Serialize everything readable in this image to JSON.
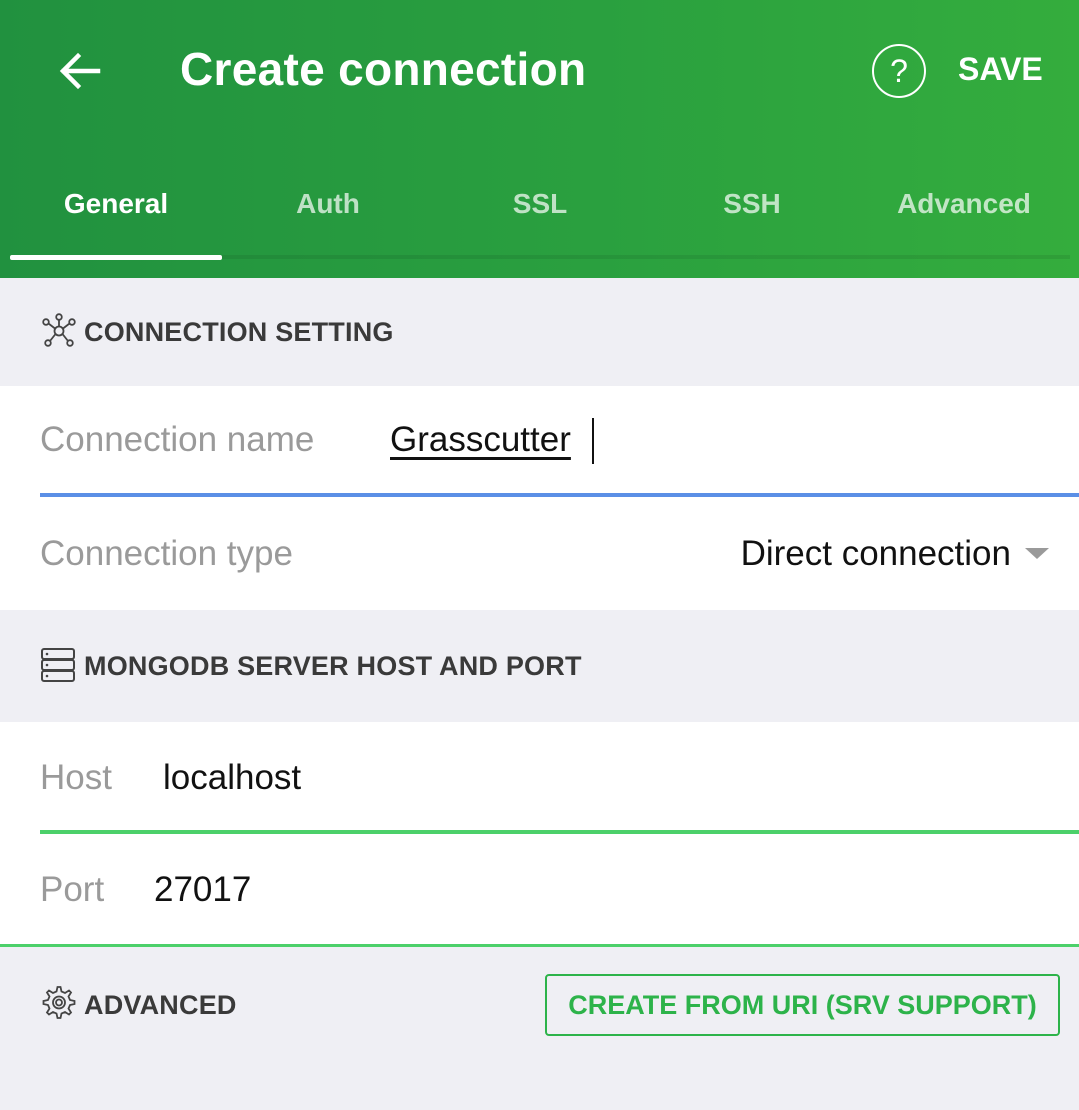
{
  "header": {
    "title": "Create connection",
    "back_icon": "arrow-back-icon",
    "help_icon": "help-circle-icon",
    "help_glyph": "?",
    "save_label": "SAVE",
    "bg_color_start": "#21913f",
    "bg_color_end": "#34ad3d"
  },
  "tabs": [
    {
      "label": "General",
      "active": true
    },
    {
      "label": "Auth",
      "active": false
    },
    {
      "label": "SSL",
      "active": false
    },
    {
      "label": "SSH",
      "active": false
    },
    {
      "label": "Advanced",
      "active": false
    }
  ],
  "sections": {
    "connection_setting": {
      "label": "CONNECTION SETTING",
      "icon": "network-icon"
    },
    "host_port": {
      "label": "MONGODB SERVER HOST AND PORT",
      "icon": "server-icon"
    },
    "advanced": {
      "label": "ADVANCED",
      "icon": "gear-icon"
    }
  },
  "fields": {
    "connection_name": {
      "label": "Connection name",
      "value": "Grasscutter"
    },
    "connection_type": {
      "label": "Connection type",
      "value": "Direct connection"
    },
    "host": {
      "label": "Host",
      "value": "localhost"
    },
    "port": {
      "label": "Port",
      "value": "27017"
    }
  },
  "buttons": {
    "create_from_uri": "CREATE FROM URI (SRV SUPPORT)"
  },
  "colors": {
    "accent_green": "#2db34a",
    "focus_blue": "#5b8fe6",
    "page_bg": "#efeff4"
  }
}
